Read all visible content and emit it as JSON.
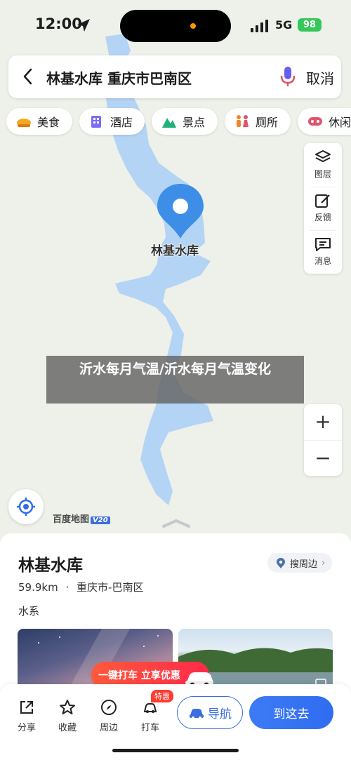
{
  "status_bar": {
    "time": "12:00",
    "network": "5G",
    "battery": "98"
  },
  "search": {
    "query": "林基水库 重庆市巴南区",
    "cancel_label": "取消"
  },
  "categories": [
    {
      "label": "美食",
      "icon": "food-icon"
    },
    {
      "label": "酒店",
      "icon": "hotel-icon"
    },
    {
      "label": "景点",
      "icon": "scenic-icon"
    },
    {
      "label": "厕所",
      "icon": "toilet-icon"
    },
    {
      "label": "休闲",
      "icon": "leisure-icon"
    }
  ],
  "map_tools": {
    "layers": "图层",
    "feedback": "反馈",
    "messages": "消息"
  },
  "zoom": {
    "in": "+",
    "out": "−"
  },
  "map": {
    "pin_label": "林基水库",
    "logo": "百度地图",
    "logo_version": "V20"
  },
  "overlay": {
    "text": "沂水每月气温/沂水每月气温变化"
  },
  "place": {
    "name": "林基水库",
    "nearby_label": "搜周边",
    "distance": "59.9km",
    "separator": "·",
    "location": "重庆市-巴南区",
    "category": "水系"
  },
  "promo": {
    "text": "一键打车 立享优惠",
    "badge": "特惠"
  },
  "actions": {
    "share": "分享",
    "favorite": "收藏",
    "nearby": "周边",
    "taxi": "打车"
  },
  "buttons": {
    "navigate": "导航",
    "go_here": "到这去"
  },
  "colors": {
    "water": "#b3d4f5",
    "accent": "#3b6fe0",
    "pin": "#3d8ee6"
  }
}
